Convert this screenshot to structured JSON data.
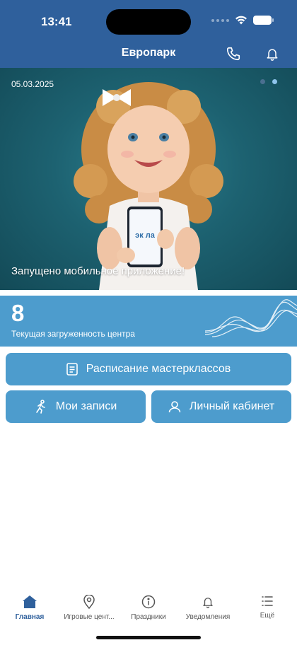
{
  "status_bar": {
    "time": "13:41"
  },
  "header": {
    "title": "Европарк",
    "icons": [
      "phone-icon",
      "bell-icon"
    ]
  },
  "banner": {
    "date": "05.03.2025",
    "caption": "Запущено мобильное приложение!",
    "pages": 2,
    "active_page": 2,
    "phone_logo_text": "эк ла"
  },
  "load": {
    "value": "8",
    "label": "Текущая загруженность центра"
  },
  "buttons": {
    "schedule": "Расписание мастерклассов",
    "my_records": "Мои записи",
    "account": "Личный кабинет"
  },
  "tabs": [
    {
      "label": "Главная",
      "icon": "home-icon",
      "active": true
    },
    {
      "label": "Игровые цент...",
      "icon": "map-pin-icon",
      "active": false
    },
    {
      "label": "Праздники",
      "icon": "info-icon",
      "active": false
    },
    {
      "label": "Уведомления",
      "icon": "bell-icon",
      "active": false
    },
    {
      "label": "Ещё",
      "icon": "list-icon",
      "active": false
    }
  ],
  "colors": {
    "header": "#2f609c",
    "accent": "#4d9ccd",
    "active_tab": "#2f609c"
  }
}
